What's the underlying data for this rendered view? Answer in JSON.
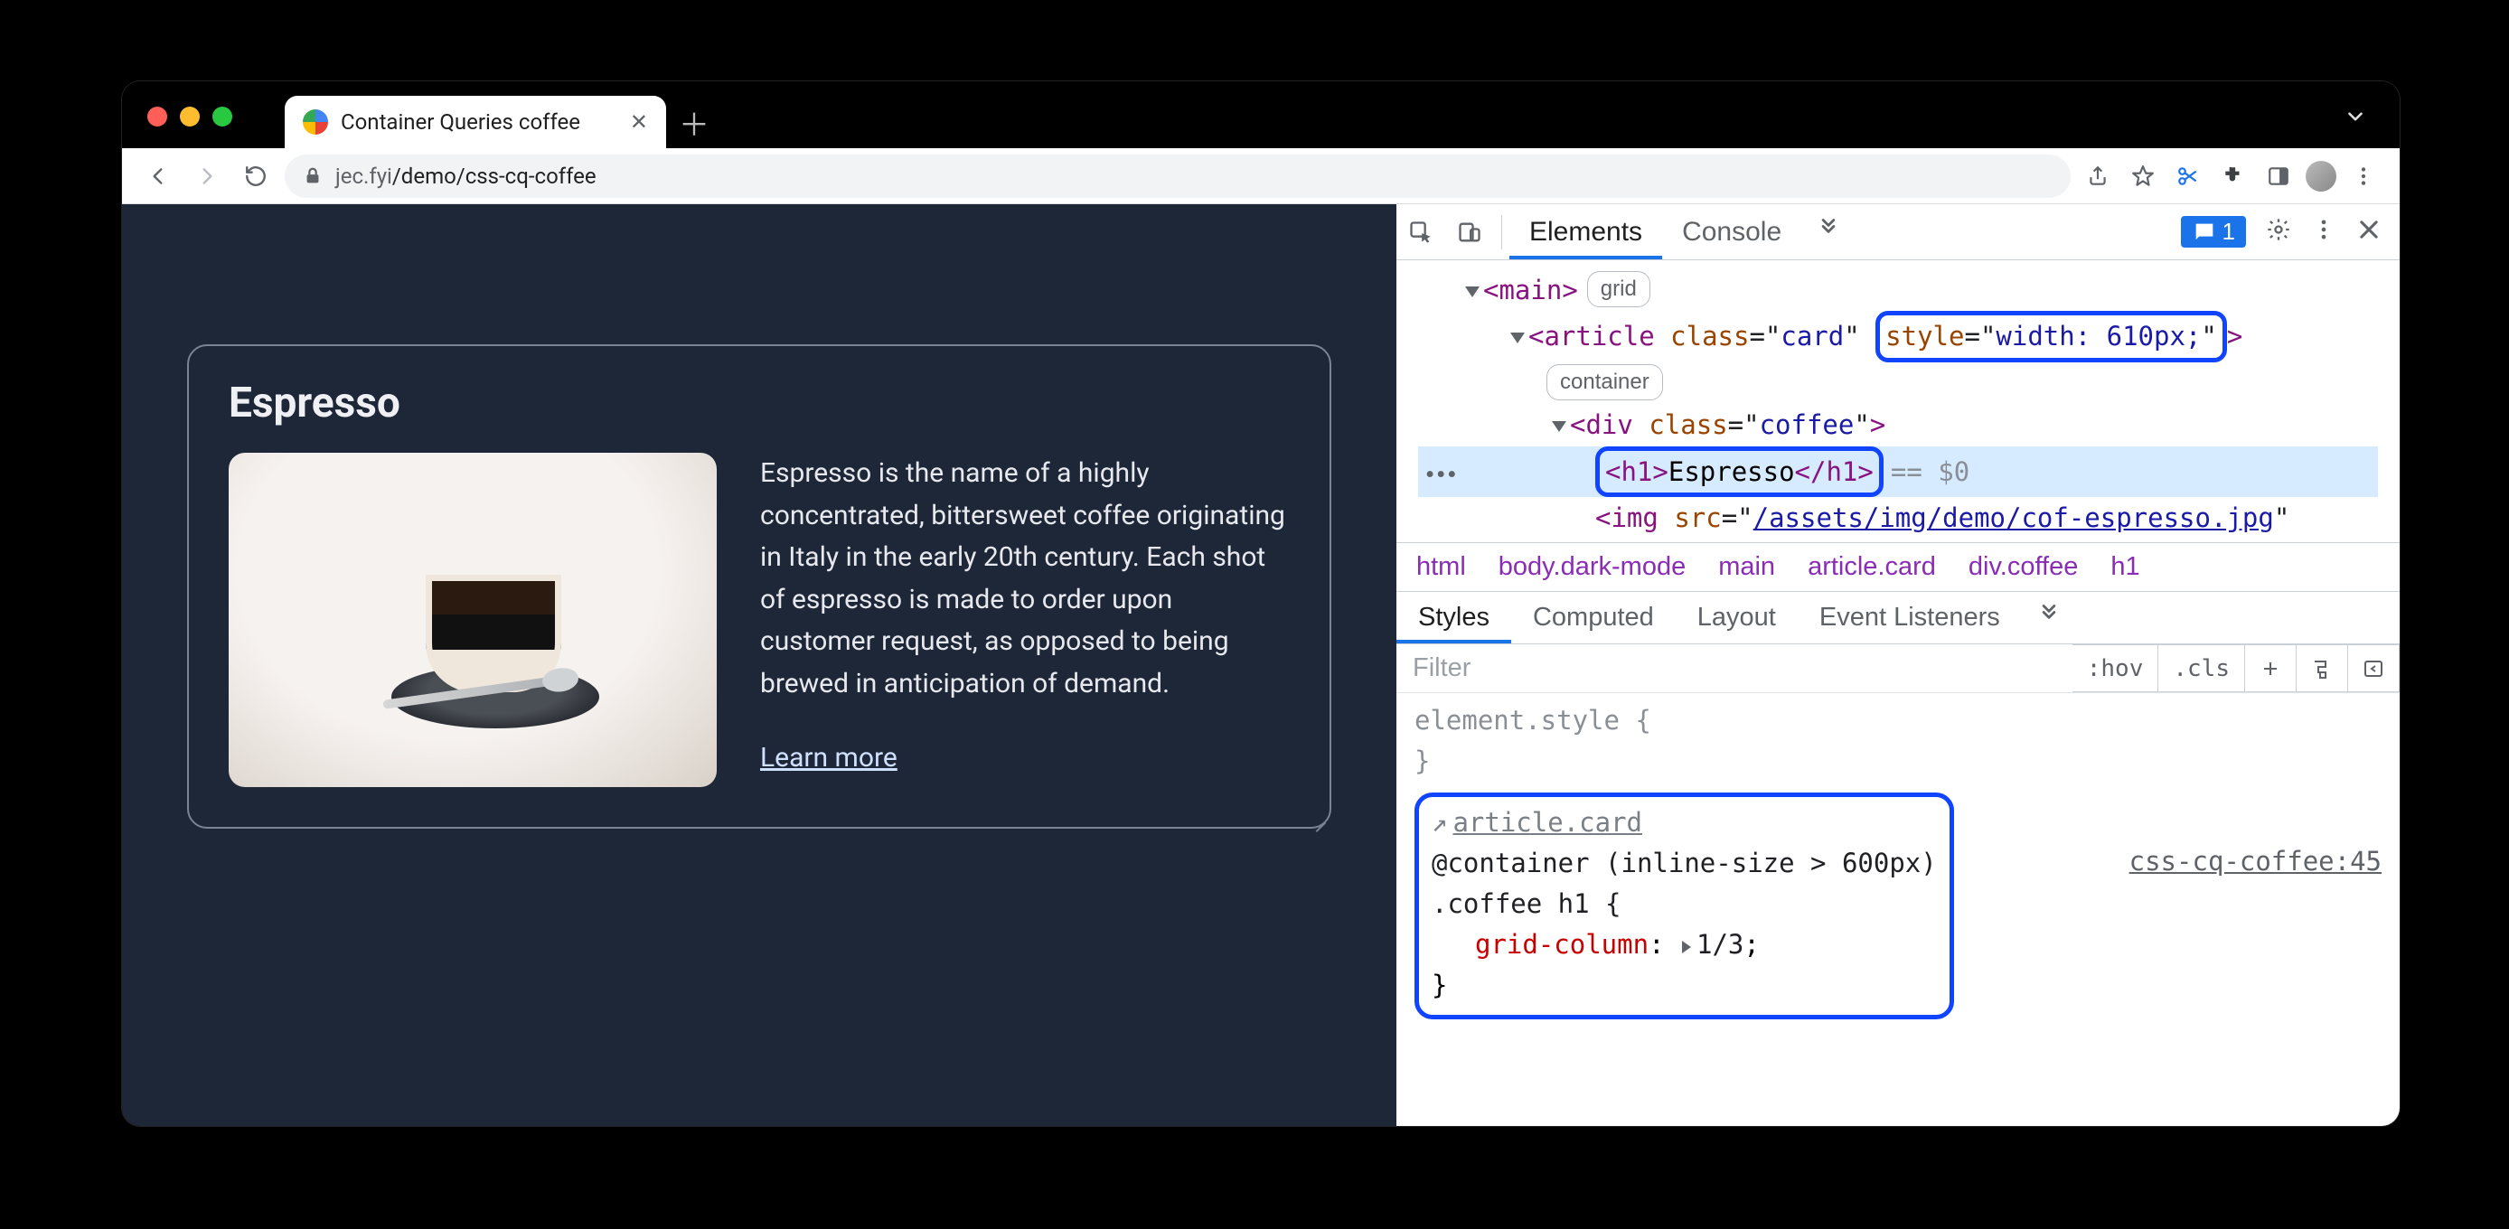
{
  "window": {
    "tab_title": "Container Queries coffee",
    "url_host": "jec.fyi",
    "url_path": "/demo/css-cq-coffee"
  },
  "page": {
    "card_title": "Espresso",
    "card_description": "Espresso is the name of a highly concentrated, bittersweet coffee originating in Italy in the early 20th century. Each shot of espresso is made to order upon customer request, as opposed to being brewed in anticipation of demand.",
    "learn_more": "Learn more"
  },
  "devtools": {
    "tabs": {
      "elements": "Elements",
      "console": "Console"
    },
    "issues_count": "1",
    "dom": {
      "main_tag": "main",
      "main_badge": "grid",
      "article_open": "article",
      "article_class_attr": "class",
      "article_class_val": "card",
      "article_style_attr": "style",
      "article_style_val": "width: 610px;",
      "article_badge": "container",
      "div_tag": "div",
      "div_class_attr": "class",
      "div_class_val": "coffee",
      "h1_tag": "h1",
      "h1_text": "Espresso",
      "eq0": "== $0",
      "img_tag": "img",
      "img_src_attr": "src",
      "img_src_val": "/assets/img/demo/cof-espresso.jpg"
    },
    "breadcrumbs": [
      "html",
      "body.dark-mode",
      "main",
      "article.card",
      "div.coffee",
      "h1"
    ],
    "styles_tabs": {
      "styles": "Styles",
      "computed": "Computed",
      "layout": "Layout",
      "event_listeners": "Event Listeners"
    },
    "styles_toolbar": {
      "filter": "Filter",
      "hov": ":hov",
      "cls": ".cls"
    },
    "rules": {
      "element_style": "element.style {",
      "element_style_close": "}",
      "container_link": "article.card",
      "container_query": "@container (inline-size > 600px)",
      "selector": ".coffee h1 {",
      "prop": "grid-column",
      "val": "1/3",
      "close": "}",
      "source": "css-cq-coffee:45"
    }
  }
}
